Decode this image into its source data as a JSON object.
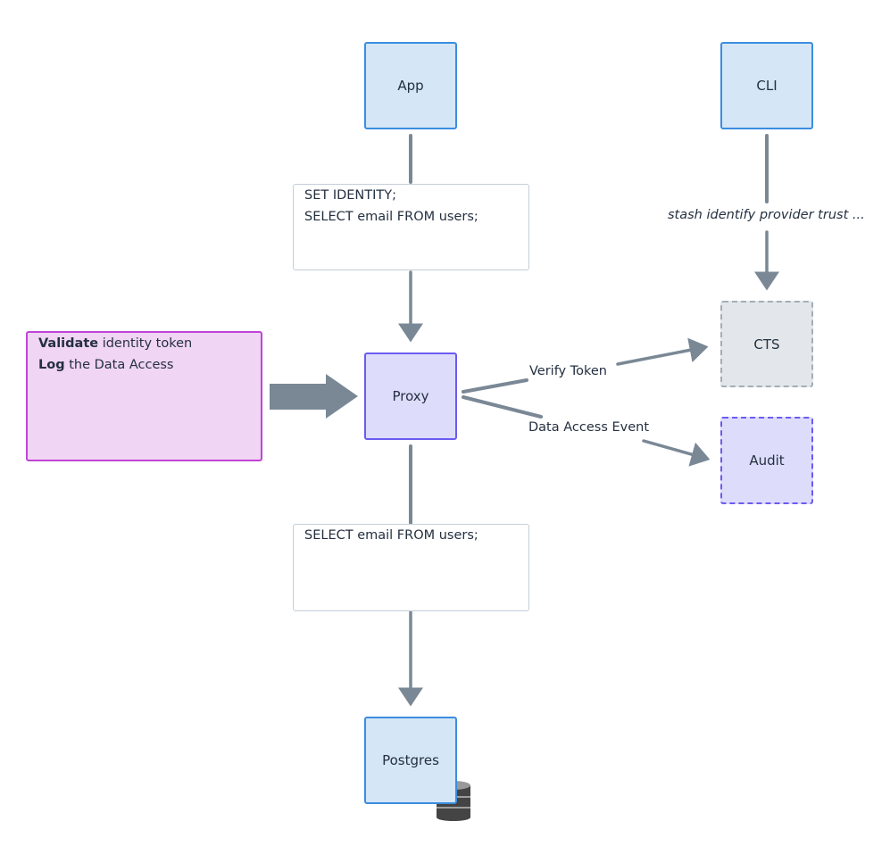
{
  "nodes": {
    "app": "App",
    "cli": "CLI",
    "proxy": "Proxy",
    "cts": "CTS",
    "audit": "Audit",
    "postgres": "Postgres"
  },
  "notes": {
    "top": [
      "SET IDENTITY;",
      "SELECT email FROM users;"
    ],
    "bottom": "SELECT email FROM users;",
    "side": {
      "line1_bold": "Validate",
      "line1_rest": " identity token",
      "line2_bold": "Log",
      "line2_rest": " the Data Access"
    }
  },
  "edges": {
    "cli_cts": "stash identify provider trust ...",
    "verify": "Verify Token",
    "event": "Data Access Event"
  },
  "icons": {
    "postgres": "database-icon"
  },
  "colors": {
    "service": "#d5e6f6",
    "proxy": "#dedcfb",
    "side_note": "#f1d5f4",
    "arrow": "#7a8896"
  }
}
